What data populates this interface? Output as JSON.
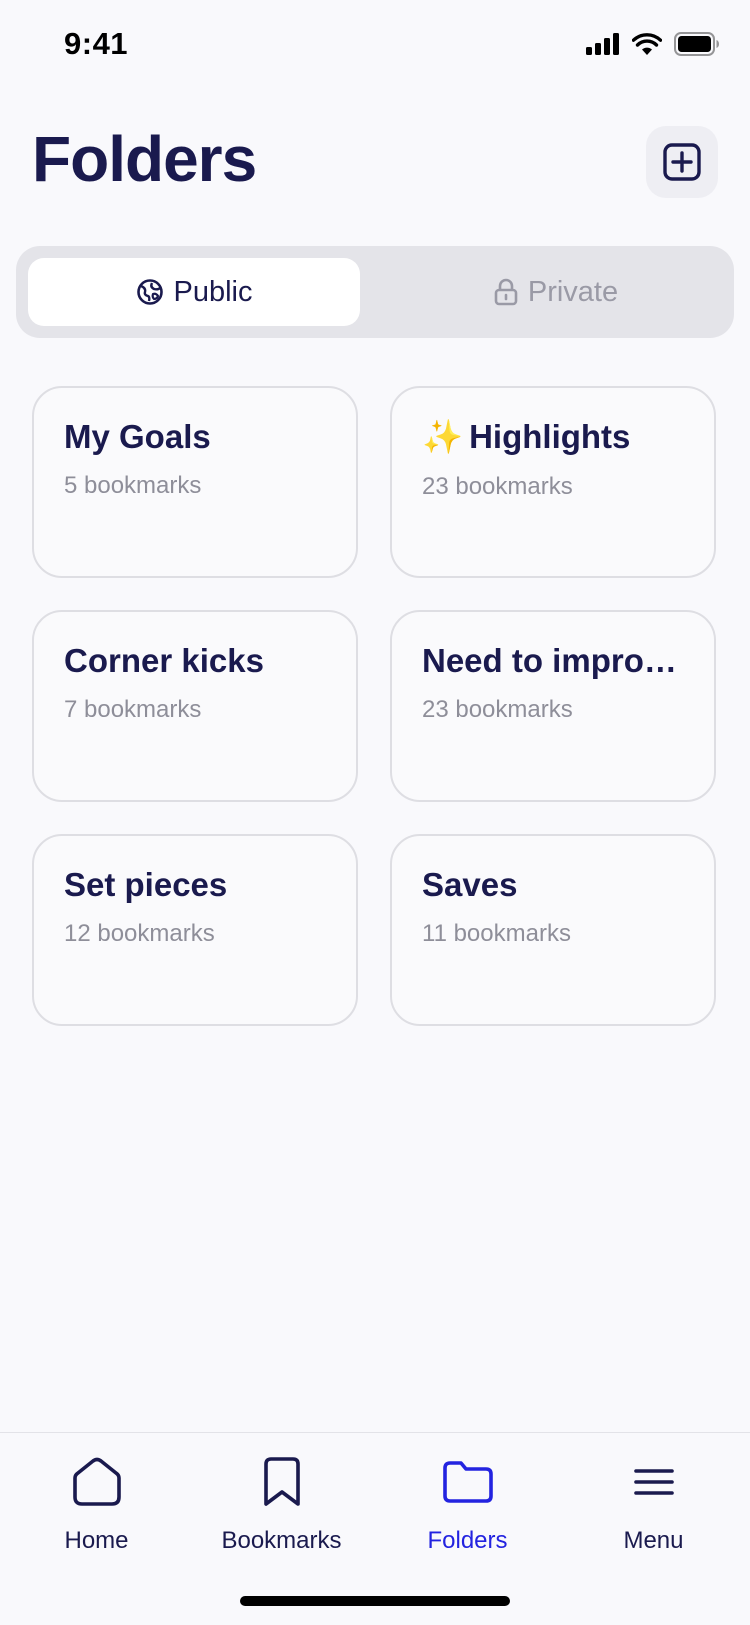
{
  "status_bar": {
    "time": "9:41"
  },
  "header": {
    "title": "Folders"
  },
  "segments": {
    "public_label": "Public",
    "private_label": "Private",
    "selected": "Public"
  },
  "folders": [
    {
      "title": "My Goals",
      "subtitle": "5 bookmarks"
    },
    {
      "emoji": "✨",
      "title": "Highlights",
      "subtitle": "23 bookmarks"
    },
    {
      "title": "Corner kicks",
      "subtitle": "7 bookmarks"
    },
    {
      "title": "Need to improv...",
      "subtitle": "23 bookmarks"
    },
    {
      "title": "Set pieces",
      "subtitle": "12 bookmarks"
    },
    {
      "title": "Saves",
      "subtitle": "11 bookmarks"
    }
  ],
  "tabbar": {
    "items": [
      {
        "label": "Home",
        "icon": "home-icon"
      },
      {
        "label": "Bookmarks",
        "icon": "bookmark-icon"
      },
      {
        "label": "Folders",
        "icon": "folder-icon"
      },
      {
        "label": "Menu",
        "icon": "menu-icon"
      }
    ],
    "active": "Folders"
  },
  "colors": {
    "primary": "#1A1A4E",
    "accent": "#2323E0",
    "muted": "#8E8E99",
    "background": "#F9F9FC"
  }
}
